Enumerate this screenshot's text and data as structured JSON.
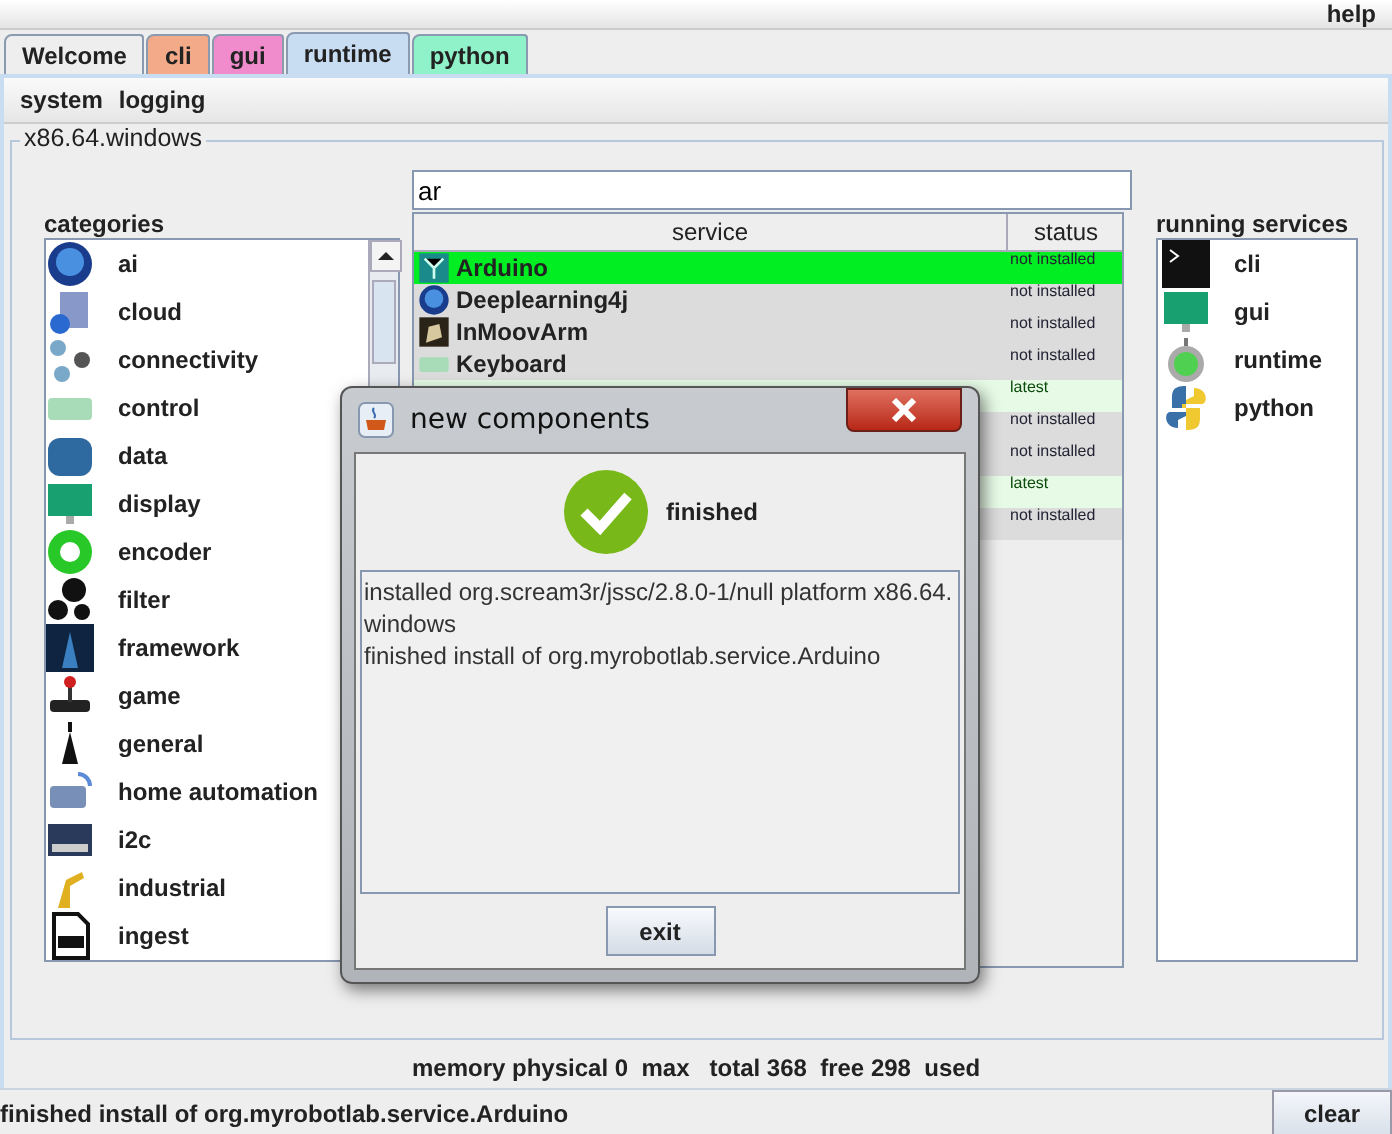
{
  "menu": [
    {
      "label": "help"
    }
  ],
  "tabs": [
    {
      "label": "Welcome",
      "selected": false,
      "color": "#eeeeee"
    },
    {
      "label": "cli",
      "selected": false,
      "color": "#f2aa88"
    },
    {
      "label": "gui",
      "selected": false,
      "color": "#f08ccc"
    },
    {
      "label": "runtime",
      "selected": true,
      "color": "#c8dcf2"
    },
    {
      "label": "python",
      "selected": false,
      "color": "#90f2c8"
    }
  ],
  "toolbar": [
    "system",
    "logging"
  ],
  "platform": "x86.64.windows",
  "search": {
    "value": "ar"
  },
  "categories": {
    "title": "categories",
    "items": [
      "ai",
      "cloud",
      "connectivity",
      "control",
      "data",
      "display",
      "encoder",
      "filter",
      "framework",
      "game",
      "general",
      "home automation",
      "i2c",
      "industrial",
      "ingest"
    ]
  },
  "services_table": {
    "columns": [
      "service",
      "status"
    ],
    "rows": [
      {
        "service": "Arduino",
        "status": "not installed",
        "kind": "available",
        "selected": true
      },
      {
        "service": "Deeplearning4j",
        "status": "not installed",
        "kind": "available",
        "selected": false
      },
      {
        "service": "InMoovArm",
        "status": "not installed",
        "kind": "available",
        "selected": false
      },
      {
        "service": "Keyboard",
        "status": "not installed",
        "kind": "available",
        "selected": false
      },
      {
        "status": "latest",
        "kind": "installed",
        "selected": false
      },
      {
        "status": "not installed",
        "kind": "available",
        "selected": false
      },
      {
        "status": "not installed",
        "kind": "available",
        "selected": false
      },
      {
        "status": "latest",
        "kind": "installed",
        "selected": false
      },
      {
        "status": "not installed",
        "kind": "available",
        "selected": false
      }
    ]
  },
  "running_services": {
    "title": "running services",
    "items": [
      "cli",
      "gui",
      "runtime",
      "python"
    ]
  },
  "memory": "memory physical 0  max   total 368  free 298  used",
  "status_bar": {
    "message": "finished install of org.myrobotlab.service.Arduino",
    "button": "clear"
  },
  "dialog": {
    "title": "new components",
    "status": "finished",
    "log": [
      "installed org.scream3r/jssc/2.8.0-1/null platform x86.64.windows",
      "finished install of org.myrobotlab.service.Arduino"
    ],
    "button": "exit"
  }
}
